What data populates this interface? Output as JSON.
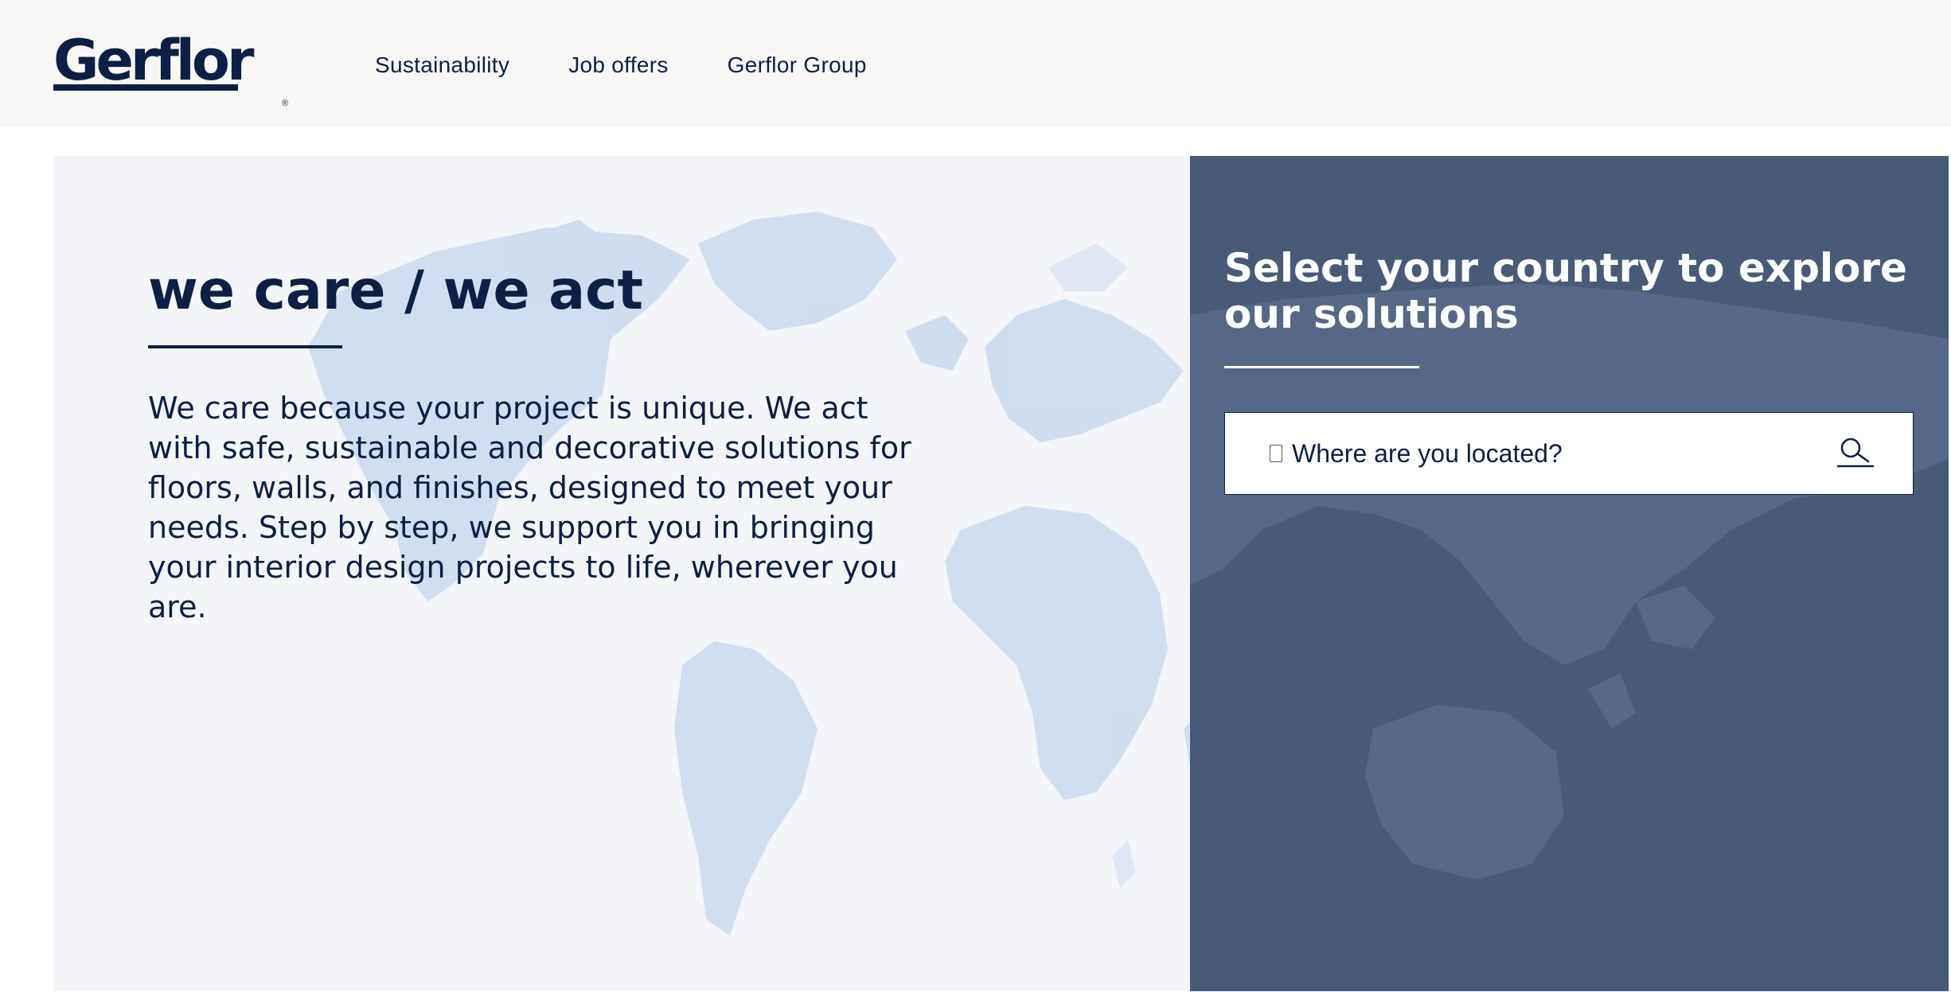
{
  "header": {
    "logo_text": "Gerflor",
    "logo_reg": "®",
    "nav": [
      {
        "label": "Sustainability"
      },
      {
        "label": "Job offers"
      },
      {
        "label": "Gerflor Group"
      }
    ]
  },
  "hero": {
    "title": "we care / we act",
    "body": "We care because your project is unique. We act with safe, sustainable and decorative solutions for floors, walls, and finishes, designed to meet your needs. Step by step, we support you in bringing your interior design projects to life, wherever you are."
  },
  "country_selector": {
    "title": "Select your country to explore our solutions",
    "search": {
      "placeholder": "Where are you located?",
      "value": ""
    },
    "icons": {
      "search": "search-icon",
      "prefix": "missing-glyph-icon"
    }
  },
  "colors": {
    "navy": "#0d1f45",
    "panel": "#3f5170",
    "map": "#c9d9ee",
    "hero_bg": "#f3f5f8",
    "header_bg": "#f8f7f6"
  }
}
